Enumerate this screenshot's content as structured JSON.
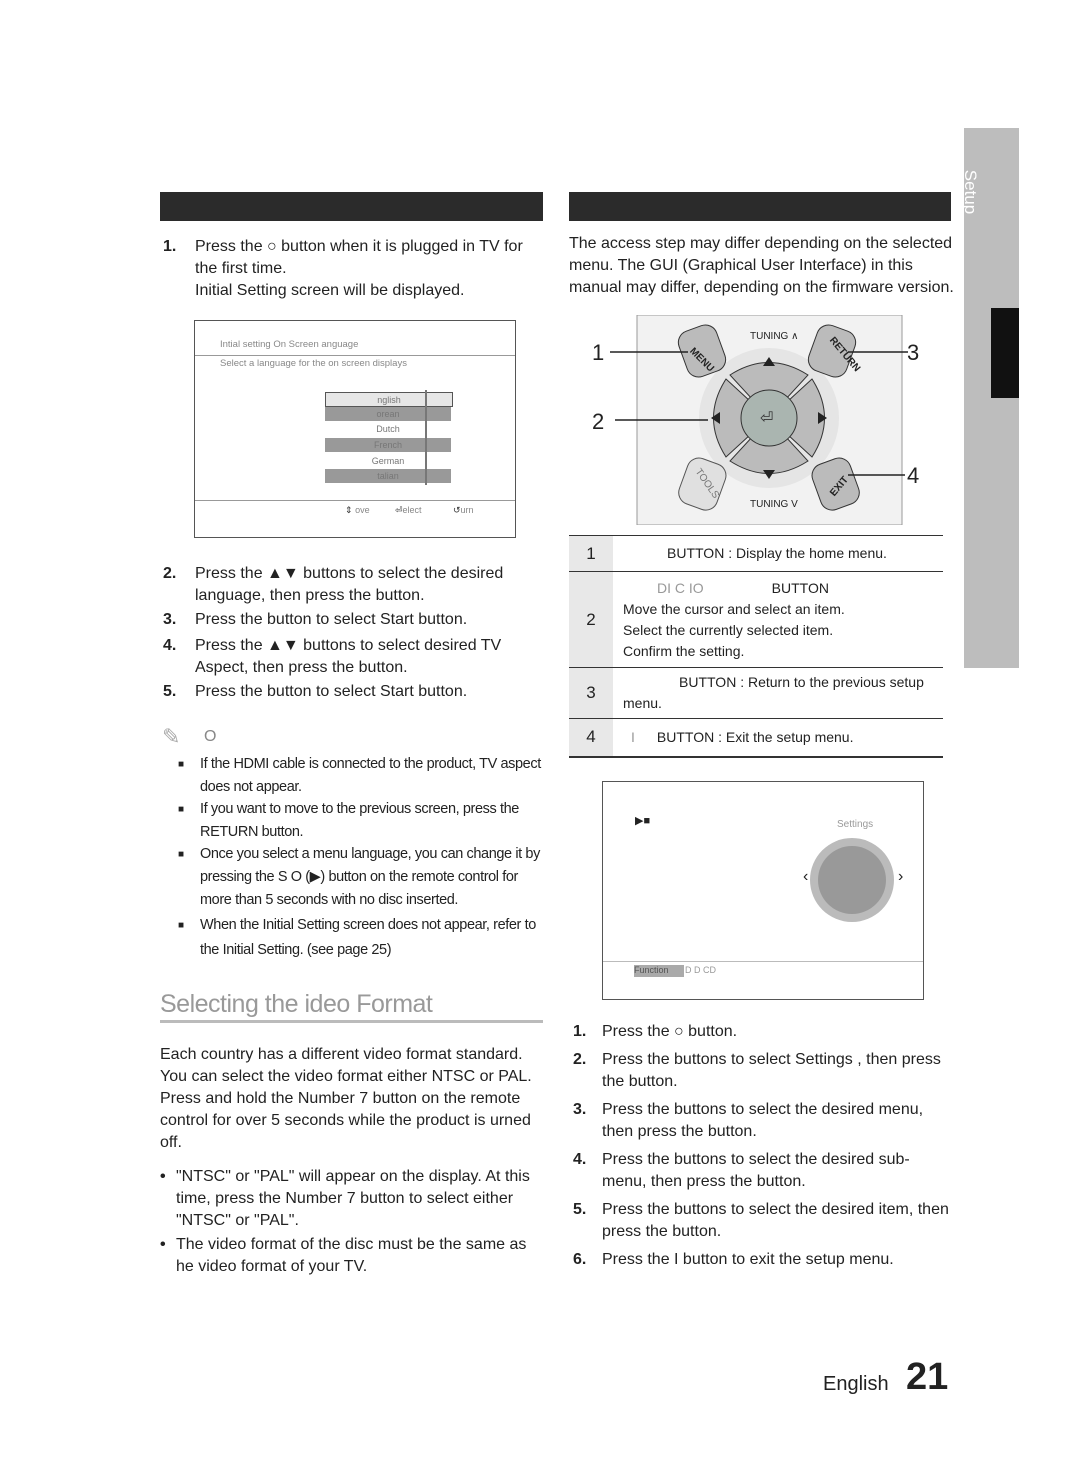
{
  "side_tab": {
    "label": "Setup"
  },
  "left": {
    "header_bar": "",
    "step1": {
      "num": "1.",
      "text": "Press the ○        button when it is plugged in TV for the first time.",
      "sub": "Initial Setting screen will be displayed."
    },
    "screen": {
      "title": "Intial setting   On Screen  anguage",
      "subtitle": "Select a language for the on screen displays",
      "languages": [
        "nglish",
        "orean",
        "Dutch",
        "French",
        "German",
        "talian"
      ],
      "footer": {
        "move": "ove",
        "select": "elect",
        "return": "urn"
      }
    },
    "steps": [
      {
        "num": "2.",
        "text": "Press the ▲▼ buttons to select the desired language, then press the             button."
      },
      {
        "num": "3.",
        "text": "Press the             button to select Start button."
      },
      {
        "num": "4.",
        "text": "Press the ▲▼ buttons to select desired TV Aspect, then press the             button."
      },
      {
        "num": "5.",
        "text": "Press the             button to select Start button."
      }
    ],
    "note_label": "O",
    "notes": [
      "If the HDMI cable is connected to the product, TV aspect does not appear.",
      "If you want to move to the previous screen, press the RETURN button.",
      "Once you select a menu language, you can change it by pressing the S O     (▶) button on the remote control for more than 5 seconds with no disc inserted.",
      "When the Initial Setting screen does not appear, refer to the Initial Setting. (see page 25)"
    ],
    "section_title": "Selecting the  ideo Format",
    "section_body": "Each country has a different video format standard. You can select the video format either NTSC or PAL. Press and hold the Number 7 button on the remote control for over 5 seconds while the product is urned off.",
    "bullets": [
      "\"NTSC\" or \"PAL\" will appear on the display. At this time, press the Number 7 button to select either \"NTSC\" or \"PAL\".",
      "The video format of the disc must be the same as he video format of your TV."
    ]
  },
  "right": {
    "intro": "The access step may differ depending on the selected menu. The GUI (Graphical User Interface) in this manual may differ, depending on the firmware version.",
    "remote": {
      "callouts": [
        "1",
        "2",
        "3",
        "4"
      ],
      "labels": {
        "menu": "MENU",
        "return": "RETURN",
        "tools": "TOOLS",
        "exit": "EXIT",
        "tuning_up": "TUNING ∧",
        "tuning_down": "TUNING V"
      }
    },
    "table": [
      {
        "num": "1",
        "text": "BUTTON : Display the home menu."
      },
      {
        "num": "2",
        "head": "DI  C IO",
        "head2": "BUTTON",
        "lines": [
          "Move the cursor and select an item.",
          "Select the currently selected item.",
          "Confirm the setting."
        ]
      },
      {
        "num": "3",
        "text": "BUTTON : Return to the previous setup menu."
      },
      {
        "num": "4",
        "text": "BUTTON : Exit the setup menu.",
        "prefix": "I"
      }
    ],
    "home_screen": {
      "settings": "Settings",
      "function": "Function",
      "disc": "D D CD"
    },
    "steps": [
      {
        "num": "1.",
        "text": "Press the ○          button."
      },
      {
        "num": "2.",
        "text": "Press the        buttons to select Settings   , then press the             button."
      },
      {
        "num": "3.",
        "text": "Press the        buttons to select the desired menu, then press the             button."
      },
      {
        "num": "4.",
        "text": "Press the        buttons to select the desired sub-menu, then press the             button."
      },
      {
        "num": "5.",
        "text": "Press the        buttons to select the desired item, then press the             button."
      },
      {
        "num": "6.",
        "text": "Press the  I      button to exit the setup menu."
      }
    ]
  },
  "footer": {
    "language": "English",
    "page": "21"
  }
}
